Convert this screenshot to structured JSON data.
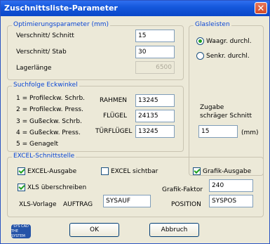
{
  "window": {
    "title": "Zuschnittsliste-Parameter",
    "close_glyph": "✕"
  },
  "optimierung": {
    "label": "Optimierungsparameter (mm)",
    "verschnitt_schnitt_label": "Verschnitt/ Schnitt",
    "verschnitt_schnitt_value": "15",
    "verschnitt_stab_label": "Verschnitt/ Stab",
    "verschnitt_stab_value": "30",
    "lagerlaenge_label": "Lagerlänge",
    "lagerlaenge_value": "6500"
  },
  "glasleisten": {
    "label": "Glasleisten",
    "options": [
      "Waagr. durchl.",
      "Senkr. durchl."
    ],
    "selected": "Waagr. durchl."
  },
  "suchfolge": {
    "label": "Suchfolge Eckwinkel",
    "items": [
      "1 = Profileckw. Schrb.",
      "2 = Profileckw. Press.",
      "3 = Gußeckw. Schrb.",
      "4 = Gußeckw. Press.",
      "5 = Genagelt"
    ],
    "rahmen_label": "RAHMEN",
    "rahmen_value": "13245",
    "fluegel_label": "FLÜGEL",
    "fluegel_value": "24135",
    "tuerfluegel_label": "TÜRFLÜGEL",
    "tuerfluegel_value": "13245",
    "zugabe_label_1": "Zugabe",
    "zugabe_label_2": "schräger Schnitt",
    "zugabe_value": "15",
    "zugabe_unit": "(mm)"
  },
  "excel": {
    "label": "EXCEL-Schnittstelle",
    "excel_ausgabe_label": "EXCEL-Ausgabe",
    "excel_ausgabe_checked": true,
    "excel_sichtbar_label": "EXCEL sichtbar",
    "excel_sichtbar_checked": false,
    "grafik_ausgabe_label": "Grafik-Ausgabe",
    "grafik_ausgabe_checked": true,
    "xls_ueberschreiben_label": "XLS überschreiben",
    "xls_ueberschreiben_checked": true,
    "grafik_faktor_label": "Grafik-Faktor",
    "grafik_faktor_value": "240",
    "xls_vorlage_label": "XLS-Vorlage",
    "auftrag_label": "AUFTRAG",
    "auftrag_value": "SYSAUF",
    "position_label": "POSITION",
    "position_value": "SYSPOS"
  },
  "buttons": {
    "ok": "OK",
    "abbruch": "Abbruch"
  },
  "logo": {
    "line1": "SYS CAD",
    "line2": "THE SYSTEM"
  }
}
